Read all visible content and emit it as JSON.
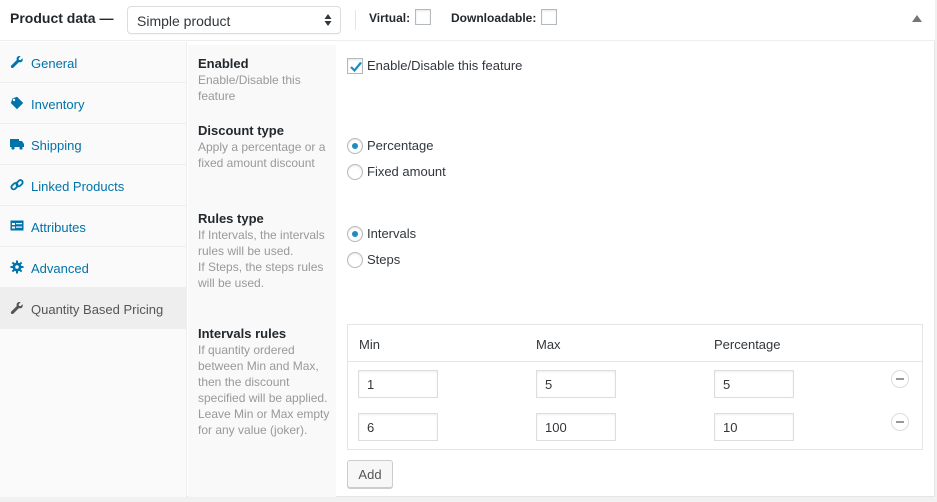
{
  "header": {
    "title": "Product data —",
    "product_type": "Simple product",
    "virtual_label": "Virtual:",
    "virtual_checked": false,
    "downloadable_label": "Downloadable:",
    "downloadable_checked": false
  },
  "sidebar": {
    "items": [
      {
        "label": "General",
        "icon": "wrench-icon"
      },
      {
        "label": "Inventory",
        "icon": "tag-icon"
      },
      {
        "label": "Shipping",
        "icon": "truck-icon"
      },
      {
        "label": "Linked Products",
        "icon": "link-icon"
      },
      {
        "label": "Attributes",
        "icon": "list-card-icon"
      },
      {
        "label": "Advanced",
        "icon": "gear-icon"
      },
      {
        "label": "Quantity Based Pricing",
        "icon": "wrench-icon",
        "active": true
      }
    ]
  },
  "fields": {
    "enabled": {
      "title": "Enabled",
      "desc": "Enable/Disable this feature",
      "checkbox_label": "Enable/Disable this feature",
      "checked": true
    },
    "discount_type": {
      "title": "Discount type",
      "desc": "Apply a percentage or a fixed amount discount",
      "options": [
        "Percentage",
        "Fixed amount"
      ],
      "selected": "Percentage"
    },
    "rules_type": {
      "title": "Rules type",
      "desc1": "If Intervals, the intervals rules will be used.",
      "desc2": "If Steps, the steps rules will be used.",
      "options": [
        "Intervals",
        "Steps"
      ],
      "selected": "Intervals"
    },
    "intervals_rules": {
      "title": "Intervals rules",
      "desc1": "If quantity ordered between Min and Max, then the discount specified will be applied.",
      "desc2": "Leave Min or Max empty for any value (joker).",
      "columns": [
        "Min",
        "Max",
        "Percentage"
      ],
      "rows": [
        {
          "min": "1",
          "max": "5",
          "percentage": "5"
        },
        {
          "min": "6",
          "max": "100",
          "percentage": "10"
        }
      ],
      "add_label": "Add"
    }
  }
}
